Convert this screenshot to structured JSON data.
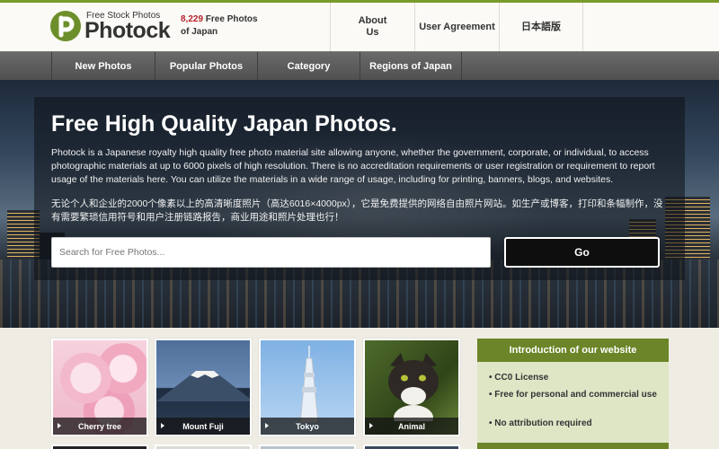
{
  "header": {
    "logo_tagline": "Free Stock Photos",
    "logo_name": "Photock",
    "photo_count": "8,229",
    "count_suffix": " Free Photos",
    "count_line2": "of Japan",
    "nav": [
      {
        "label_line1": "About",
        "label_line2": "Us"
      },
      {
        "label_line1": "User Agreement",
        "label_line2": ""
      },
      {
        "label_line1": "日本語版",
        "label_line2": ""
      }
    ]
  },
  "main_nav": [
    "New Photos",
    "Popular Photos",
    "Category",
    "Regions of Japan"
  ],
  "hero": {
    "title": "Free High Quality Japan Photos.",
    "description_en": "Photock is a Japanese royalty high quality free photo material site allowing anyone, whether the government, corporate, or individual, to access photographic materials at up to 6000 pixels of high resolution. There is no accreditation requirements or user registration or requirement to report usage of the materials here. You can utilize the materials in a wide range of usage, including for printing, banners, blogs, and websites.",
    "description_cn": "无论个人和企业的2000个像素以上的高清晰度照片（高达6016×4000px），它是免费提供的网络自由照片网站。如生产或博客，打印和条幅制作，没有需要繁琐信用符号和用户注册链路报告，商业用途和照片处理也行！",
    "search_placeholder": "Search for Free Photos...",
    "go_label": "Go"
  },
  "categories": [
    {
      "label": "Cherry tree",
      "icon": "cherry-blossom-photo"
    },
    {
      "label": "Mount Fuji",
      "icon": "mount-fuji-photo"
    },
    {
      "label": "Tokyo",
      "icon": "tokyo-skytree-photo"
    },
    {
      "label": "Animal",
      "icon": "cat-photo"
    }
  ],
  "intro": {
    "title": "Introduction of our website",
    "bullets": [
      "CC0 License",
      "Free for personal and commercial use",
      "No attribution required"
    ]
  },
  "colors": {
    "accent_green": "#6b8528",
    "count_red": "#b5222b",
    "nav_gray": "#5a5a5a"
  }
}
